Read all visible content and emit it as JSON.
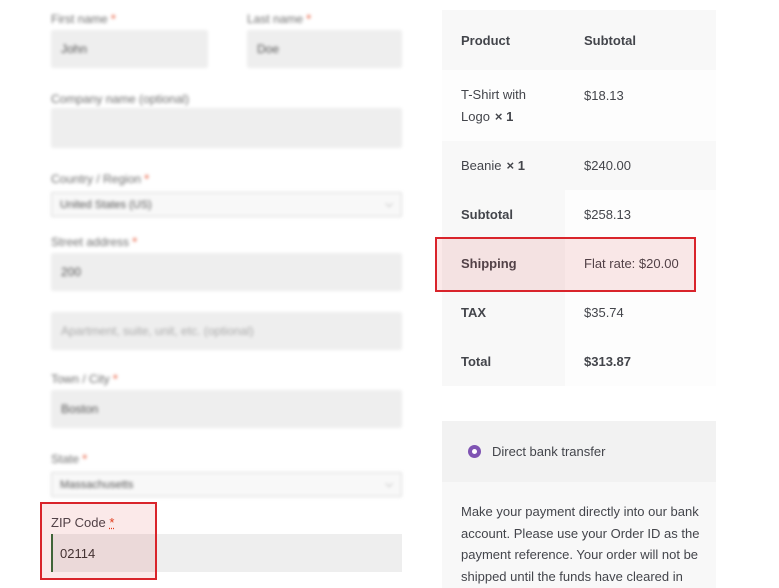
{
  "billing": {
    "first_name_label": "First name",
    "first_name_value": "John",
    "last_name_label": "Last name",
    "last_name_value": "Doe",
    "company_label": "Company name (optional)",
    "country_label": "Country / Region",
    "country_value": "United States (US)",
    "street_label": "Street address",
    "street_value": "200",
    "street2_placeholder": "Apartment, suite, unit, etc. (optional)",
    "city_label": "Town / City",
    "city_value": "Boston",
    "state_label": "State",
    "state_value": "Massachusetts",
    "required_mark": "*",
    "zip_label": "ZIP Code",
    "zip_value": "02114"
  },
  "order": {
    "col_product": "Product",
    "col_subtotal": "Subtotal",
    "items": [
      {
        "name_line1": "T-Shirt with",
        "name_line2": "Logo",
        "qty": "× 1",
        "price": "$18.13"
      },
      {
        "name": "Beanie",
        "qty": "× 1",
        "price": "$240.00"
      }
    ],
    "subtotal_label": "Subtotal",
    "subtotal_value": "$258.13",
    "shipping_label": "Shipping",
    "shipping_value": "Flat rate: $20.00",
    "tax_label": "TAX",
    "tax_value": "$35.74",
    "total_label": "Total",
    "total_value": "$313.87"
  },
  "payment": {
    "method_label": "Direct bank transfer",
    "description": "Make your payment directly into our bank account. Please use your Order ID as the payment reference. Your order will not be shipped until the funds have cleared in"
  },
  "colors": {
    "highlight": "#d9242b",
    "radio_accent": "#7f54b3"
  }
}
